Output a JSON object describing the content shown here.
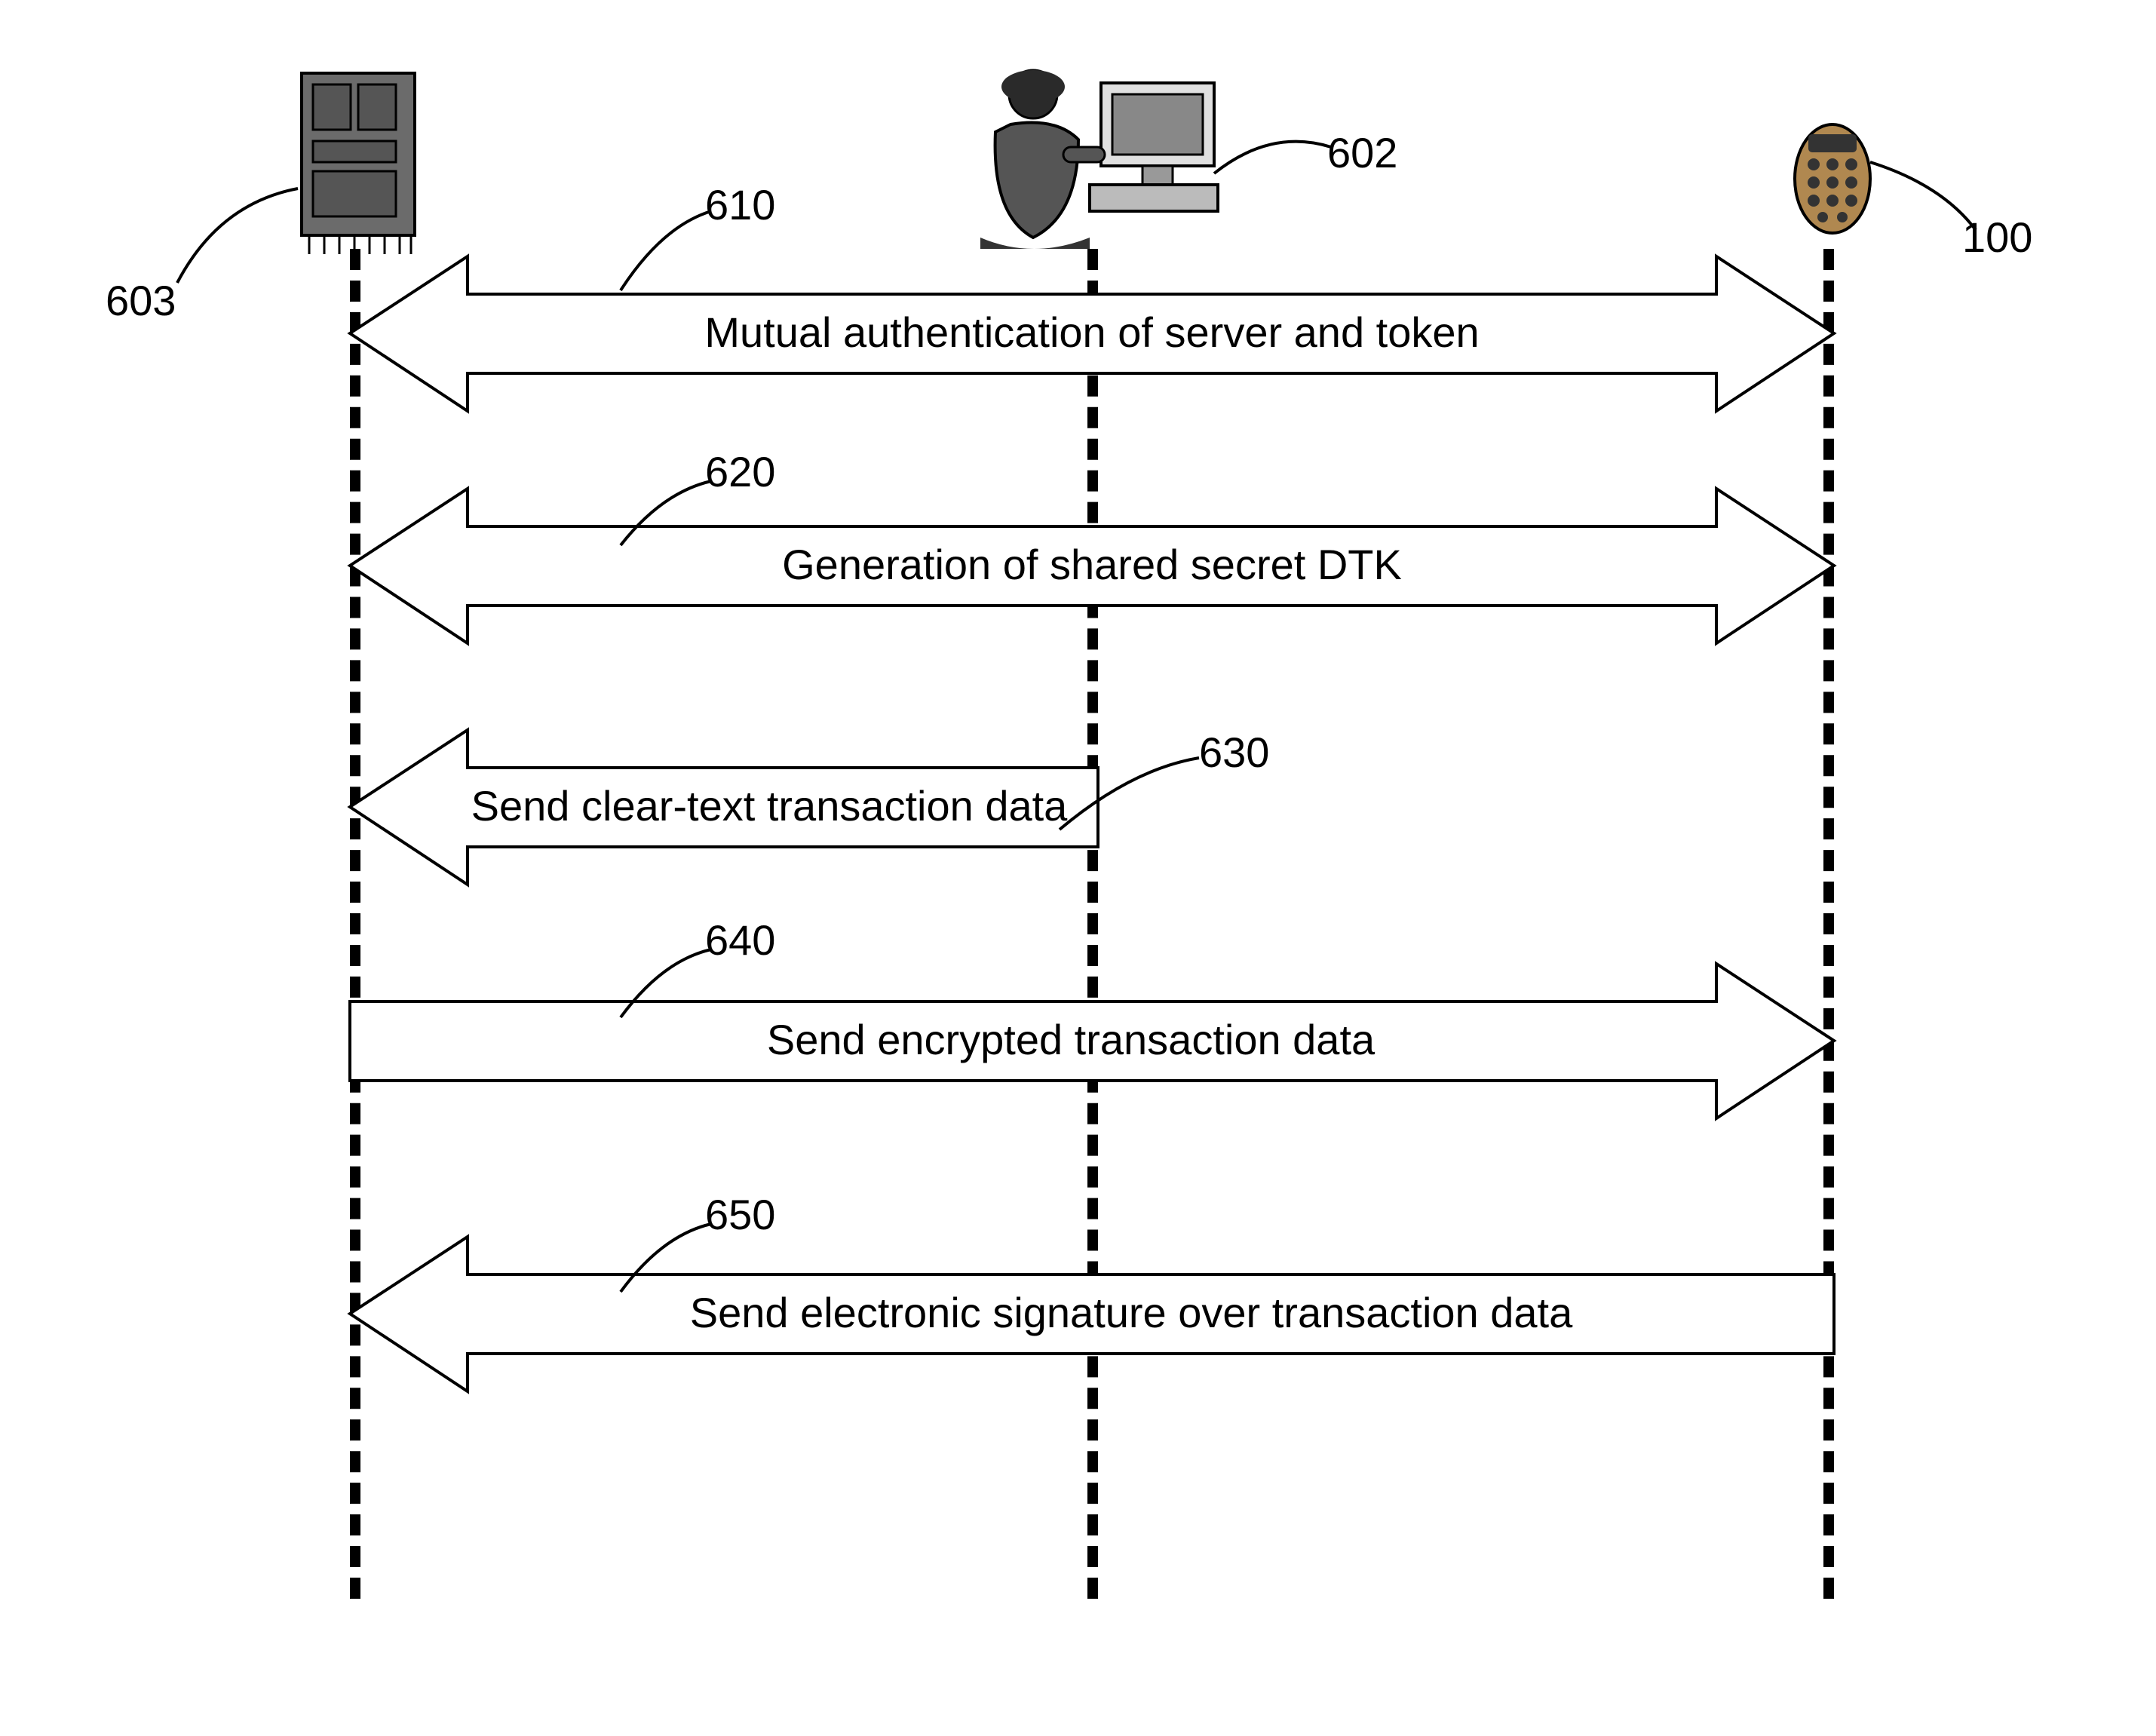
{
  "actors": {
    "server_ref": "603",
    "user_ref": "602",
    "token_ref": "100"
  },
  "steps": {
    "s610": {
      "ref": "610",
      "text": "Mutual authentication of server and token"
    },
    "s620": {
      "ref": "620",
      "text": "Generation of shared secret DTK"
    },
    "s630": {
      "ref": "630",
      "text": "Send clear-text transaction data"
    },
    "s640": {
      "ref": "640",
      "text": "Send encrypted transaction data"
    },
    "s650": {
      "ref": "650",
      "text": "Send electronic signature over transaction data"
    }
  }
}
